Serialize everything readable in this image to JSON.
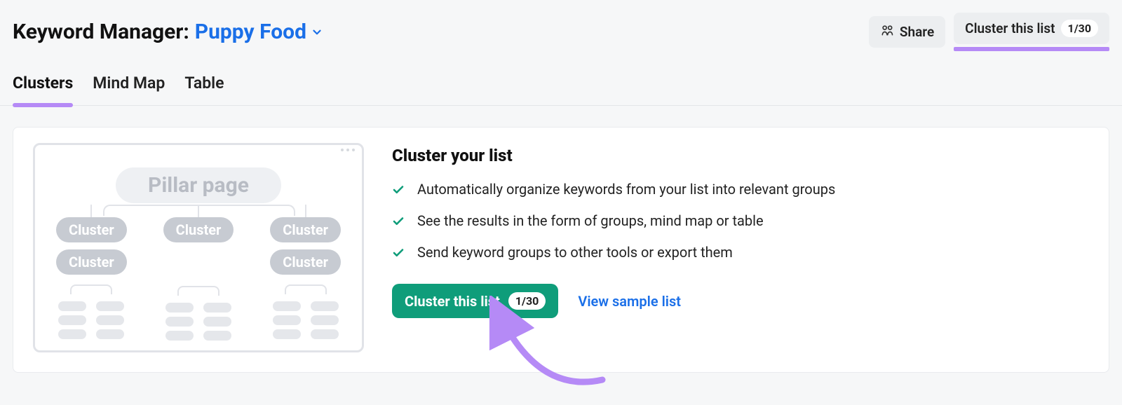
{
  "header": {
    "title_prefix": "Keyword Manager:",
    "list_name": "Puppy Food",
    "share_label": "Share",
    "cluster_button_label": "Cluster this list",
    "cluster_count": "1/30"
  },
  "tabs": {
    "clusters": "Clusters",
    "mindmap": "Mind Map",
    "table": "Table"
  },
  "illustration": {
    "pillar_label": "Pillar page",
    "cluster_label": "Cluster"
  },
  "content": {
    "heading": "Cluster your list",
    "benefits": [
      "Automatically organize keywords from your list into relevant groups",
      "See the results in the form of groups, mind map or table",
      "Send keyword groups to other tools or export them"
    ],
    "cta_label": "Cluster this list",
    "cta_count": "1/30",
    "sample_link": "View sample list"
  }
}
